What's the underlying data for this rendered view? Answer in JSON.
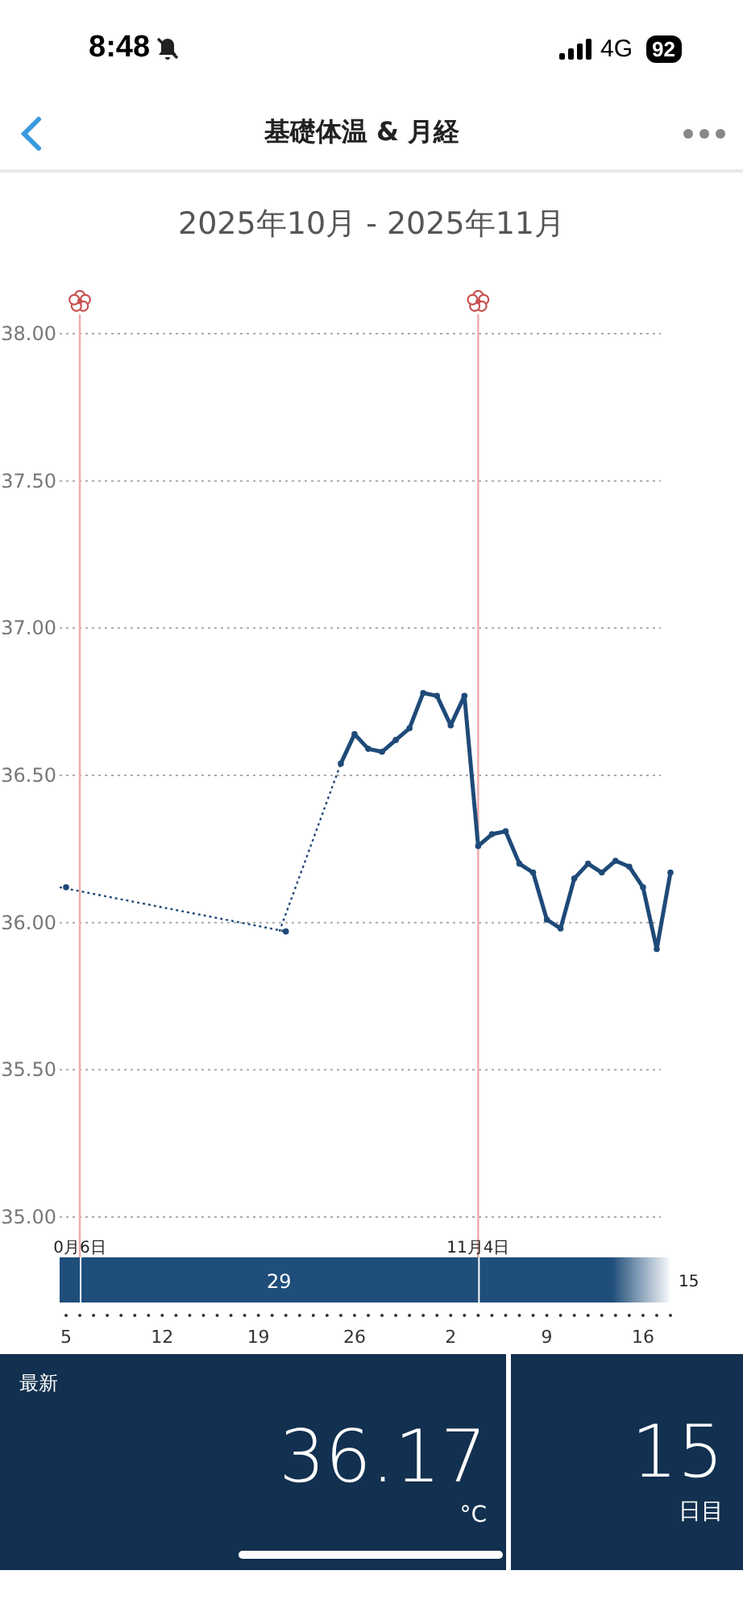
{
  "status_bar": {
    "time": "8:48",
    "network": "4G",
    "battery": "92"
  },
  "nav": {
    "title": "基礎体温 & 月経"
  },
  "period_title": "2025年10月 - 2025年11月",
  "chart_data": {
    "type": "line",
    "categories": [
      "5",
      null,
      null,
      null,
      null,
      null,
      null,
      "12",
      null,
      null,
      null,
      null,
      null,
      null,
      "19",
      null,
      null,
      null,
      null,
      null,
      null,
      "26",
      null,
      null,
      null,
      null,
      null,
      null,
      "2",
      null,
      null,
      null,
      null,
      null,
      null,
      "9",
      null,
      null,
      null,
      null,
      null,
      null,
      "16",
      null,
      null
    ],
    "grid": true,
    "series": [
      {
        "color": "#1f4a78",
        "marker": true,
        "values": [
          36.12,
          null,
          null,
          null,
          null,
          null,
          null,
          null,
          null,
          null,
          null,
          null,
          null,
          null,
          null,
          null,
          35.97,
          null,
          null,
          null,
          36.54,
          36.64,
          36.59,
          36.58,
          36.62,
          36.66,
          36.78,
          36.77,
          36.67,
          36.77,
          36.26,
          36.3,
          36.31,
          36.2,
          36.17,
          36.01,
          35.98,
          36.15,
          36.2,
          36.17,
          36.21,
          36.19,
          36.12,
          35.91,
          36.17
        ]
      }
    ],
    "ylim": [
      35,
      38
    ],
    "yticks": [
      {
        "value": 38,
        "label": "38.00"
      },
      {
        "value": 37.5,
        "label": "37.50"
      },
      {
        "value": 37,
        "label": "37.00"
      },
      {
        "value": 36.5,
        "label": "36.50"
      },
      {
        "value": 36,
        "label": "36.00"
      },
      {
        "value": 35.5,
        "label": "35.50"
      },
      {
        "value": 35,
        "label": "35.00"
      }
    ],
    "annotations": [
      "0月6日",
      "11月4日"
    ]
  },
  "cycle_bar": {
    "cycle_length": "29",
    "current_day": "15"
  },
  "latest": {
    "label": "最新",
    "value": "36.17",
    "unit": "°C"
  },
  "cycle_day": {
    "value": "15",
    "unit": "日目"
  }
}
